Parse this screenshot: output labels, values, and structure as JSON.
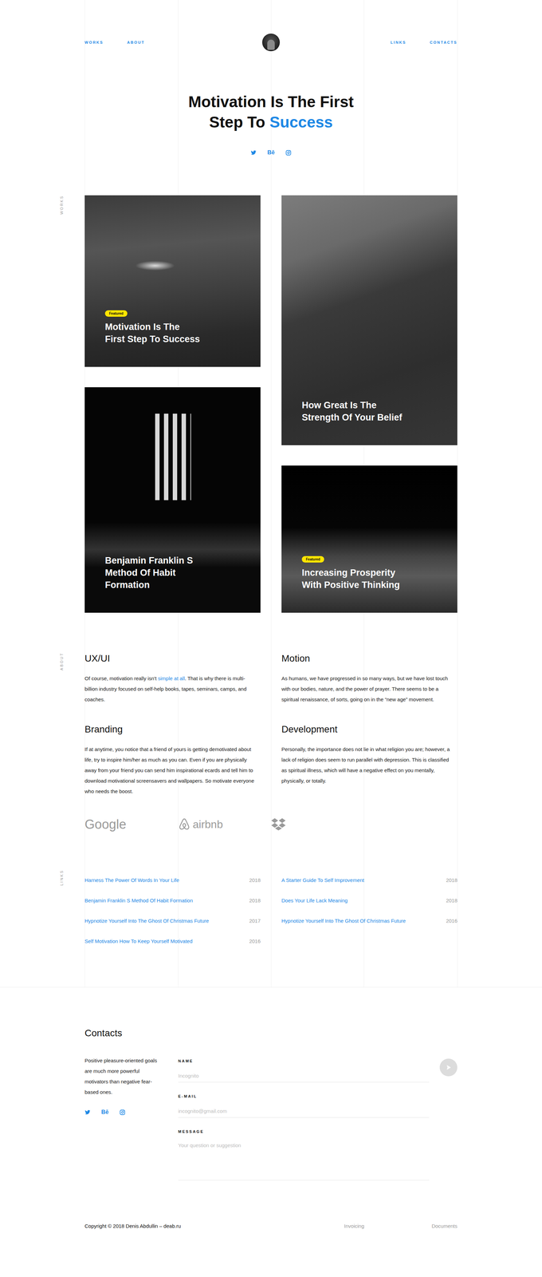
{
  "nav": {
    "left": [
      {
        "label": "WORKS"
      },
      {
        "label": "ABOUT"
      }
    ],
    "right": [
      {
        "label": "LINKS"
      },
      {
        "label": "CONTACTS"
      }
    ]
  },
  "hero": {
    "title_lines": [
      "Motivation Is The First",
      "Step To"
    ],
    "highlight": "Success"
  },
  "socials": [
    {
      "kind": "twitter"
    },
    {
      "kind": "behance",
      "glyph": "Bē"
    },
    {
      "kind": "instagram"
    }
  ],
  "works": {
    "side_label": "WORKS",
    "columns": [
      [
        {
          "title_lines": [
            "Motivation Is The",
            "First Step To Success"
          ],
          "featured": true,
          "badge": "Featured"
        },
        {
          "title_lines": [
            "Benjamin Franklin S",
            "Method Of Habit",
            "Formation"
          ],
          "featured": false
        }
      ],
      [
        {
          "title_lines": [
            "How Great Is The",
            "Strength Of Your Belief"
          ],
          "featured": false
        },
        {
          "title_lines": [
            "Increasing Prosperity",
            "With Positive Thinking"
          ],
          "featured": true,
          "badge": "Featured"
        }
      ]
    ]
  },
  "about": {
    "side_label": "ABOUT",
    "services": [
      {
        "title": "UX/UI",
        "segments": [
          {
            "text": "Of course, motivation really isn't ",
            "link": false
          },
          {
            "text": "simple at all",
            "link": true
          },
          {
            "text": ". That is why there is multi-billion industry focused on self-help books, tapes, seminars, camps, and coaches.",
            "link": false
          }
        ]
      },
      {
        "title": "Motion",
        "segments": [
          {
            "text": "As humans, we have progressed in so many ways, but we have lost touch with our bodies, nature, and the power of prayer. There seems to be a spiritual renaissance, of sorts, going on in the “new age” movement.",
            "link": false
          }
        ]
      },
      {
        "title": "Branding",
        "segments": [
          {
            "text": "If at anytime, you notice that a friend of yours is getting demotivated about life, try to inspire him/her as much as you can. Even if you are physically away from your friend you can send him inspirational ecards and tell him to download motivational screensavers and wallpapers. So motivate everyone who needs the boost.",
            "link": false
          }
        ]
      },
      {
        "title": "Development",
        "segments": [
          {
            "text": "Personally, the importance does not lie in what religion you are; however, a lack of religion does seem to run parallel with depression. This is classified as spiritual illness, which will have a negative effect on you mentally, physically, or totally.",
            "link": false
          }
        ]
      }
    ],
    "clients": [
      {
        "kind": "google",
        "name": "Google"
      },
      {
        "kind": "airbnb",
        "name": "airbnb"
      },
      {
        "kind": "dropbox"
      }
    ]
  },
  "links": {
    "side_label": "LINKS",
    "columns": [
      [
        {
          "title": "Harness The Power Of Words In Your Life",
          "year": "2018"
        },
        {
          "title": "Benjamin Franklin S Method Of Habit Formation",
          "year": "2018"
        },
        {
          "title": "Hypnotize Yourself Into The Ghost Of Christmas Future",
          "year": "2017"
        },
        {
          "title": "Self Motivation How To Keep Yourself Motivated",
          "year": "2016"
        }
      ],
      [
        {
          "title": "A Starter Guide To Self Improvement",
          "year": "2018"
        },
        {
          "title": "Does Your Life Lack Meaning",
          "year": "2018"
        },
        {
          "title": "Hypnotize Yourself Into The Ghost Of Christmas Future",
          "year": "2016"
        }
      ]
    ]
  },
  "contacts": {
    "title": "Contacts",
    "text": "Positive pleasure-oriented goals are much more powerful motivators than negative fear-based ones.",
    "fields": [
      {
        "label": "NAME",
        "placeholder": "Incognito",
        "kind": "input"
      },
      {
        "label": "E-MAIL",
        "placeholder": "incognito@gmail.com",
        "kind": "input"
      },
      {
        "label": "MESSAGE",
        "placeholder": "Your question or suggestion",
        "kind": "textarea"
      }
    ]
  },
  "footer": {
    "copyright": "Copyright © 2018 Denis Abdullin – deab.ru",
    "links": [
      "Invoicing",
      "Documents"
    ]
  }
}
